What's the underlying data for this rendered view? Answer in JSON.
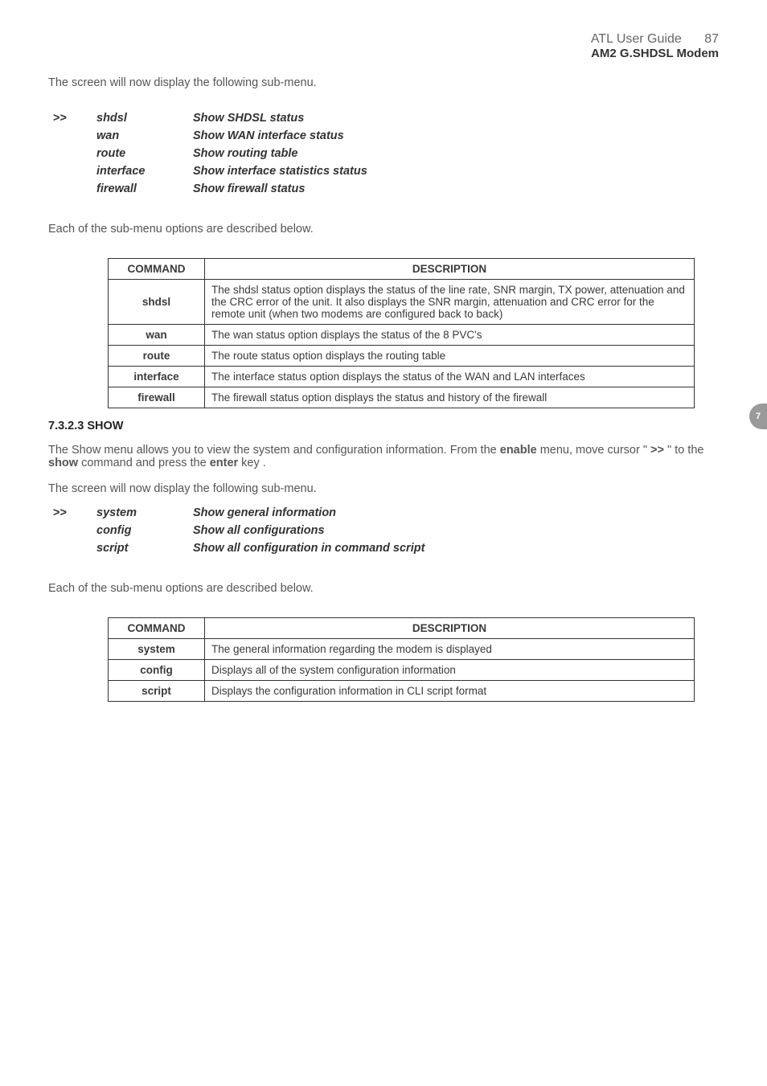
{
  "header": {
    "guide_title": "ATL User Guide",
    "page_number": "87",
    "subtitle": "AM2 G.SHDSL Modem"
  },
  "side_tab": "7",
  "intro_text_1": "The screen will now display the following sub-menu.",
  "menu1": {
    "cursor": ">>",
    "rows": [
      {
        "cmd": "shdsl",
        "desc": "Show SHDSL status"
      },
      {
        "cmd": "wan",
        "desc": "Show WAN interface status"
      },
      {
        "cmd": "route",
        "desc": "Show routing table"
      },
      {
        "cmd": "interface",
        "desc": "Show interface statistics status"
      },
      {
        "cmd": "firewall",
        "desc": "Show firewall status"
      }
    ]
  },
  "sub_desc_text": "Each of the sub-menu options are described below.",
  "table1": {
    "head_cmd": "COMMAND",
    "head_desc": "DESCRIPTION",
    "rows": [
      {
        "cmd": "shdsl",
        "desc": "The  shdsl status option displays the status of the line rate, SNR margin, TX power, attenuation and the CRC error of the unit. It also displays the SNR margin, attenuation and CRC error for the remote unit (when two modems are configured back to back)"
      },
      {
        "cmd": "wan",
        "desc": "The  wan status option displays the status of the 8 PVC's"
      },
      {
        "cmd": "route",
        "desc": "The  route status option displays the routing table"
      },
      {
        "cmd": "interface",
        "desc": "The interface status option displays the status of the WAN and LAN interfaces"
      },
      {
        "cmd": "firewall",
        "desc": "The firewall status option displays the status and history of the firewall"
      }
    ]
  },
  "section": {
    "heading": "7.3.2.3 SHOW",
    "p1_pre": "The Show menu allows you to view the system and configuration information. From the ",
    "p1_b1": "enable",
    "p1_mid1": " menu, move cursor \" ",
    "p1_b2": ">>",
    "p1_mid2": " \" to the ",
    "p1_b3": "show",
    "p1_mid3": " command and press the ",
    "p1_b4": "enter",
    "p1_post": " key ."
  },
  "intro_text_2": "The screen will now display the following sub-menu.",
  "menu2": {
    "cursor": ">>",
    "rows": [
      {
        "cmd": "system",
        "desc": "Show general information"
      },
      {
        "cmd": "config",
        "desc": "Show all configurations"
      },
      {
        "cmd": "script",
        "desc": "Show all configuration in command script"
      }
    ]
  },
  "sub_desc_text_2": "Each of the sub-menu options are described below.",
  "table2": {
    "head_cmd": "COMMAND",
    "head_desc": "DESCRIPTION",
    "rows": [
      {
        "cmd": "system",
        "desc": "The general information regarding the modem is displayed"
      },
      {
        "cmd": "config",
        "desc": "Displays all of the system configuration information"
      },
      {
        "cmd": "script",
        "desc": "Displays the configuration information in CLI script format"
      }
    ]
  }
}
